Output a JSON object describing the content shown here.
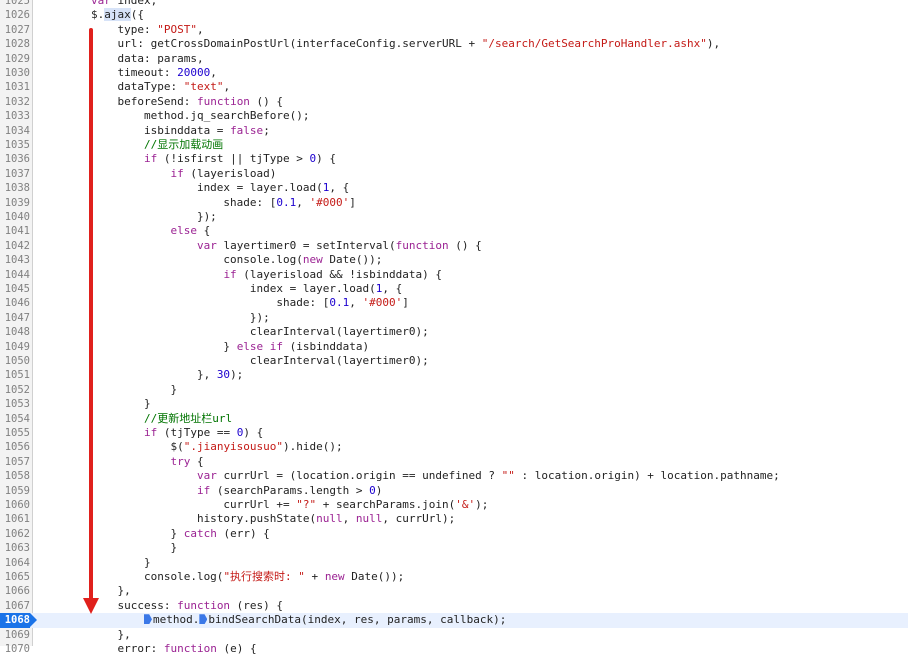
{
  "editor": {
    "current_line": "1068",
    "lines": [
      {
        "n": "1025",
        "segs": [
          [
            "        ",
            ""
          ],
          [
            "var",
            "kw"
          ],
          [
            " index;",
            ""
          ]
        ]
      },
      {
        "n": "1026",
        "segs": [
          [
            "        $.",
            ""
          ],
          [
            "ajax",
            "hl"
          ],
          [
            "({",
            ""
          ]
        ]
      },
      {
        "n": "1027",
        "segs": [
          [
            "            type: ",
            ""
          ],
          [
            "\"POST\"",
            "str"
          ],
          [
            ",",
            ""
          ]
        ]
      },
      {
        "n": "1028",
        "segs": [
          [
            "            url: getCrossDomainPostUrl(interfaceConfig.serverURL + ",
            ""
          ],
          [
            "\"/search/GetSearchProHandler.ashx\"",
            "str"
          ],
          [
            "),",
            ""
          ]
        ]
      },
      {
        "n": "1029",
        "segs": [
          [
            "            data: params,",
            ""
          ]
        ]
      },
      {
        "n": "1030",
        "segs": [
          [
            "            timeout: ",
            ""
          ],
          [
            "20000",
            "num"
          ],
          [
            ",",
            ""
          ]
        ]
      },
      {
        "n": "1031",
        "segs": [
          [
            "            dataType: ",
            ""
          ],
          [
            "\"text\"",
            "str"
          ],
          [
            ",",
            ""
          ]
        ]
      },
      {
        "n": "1032",
        "segs": [
          [
            "            beforeSend: ",
            ""
          ],
          [
            "function",
            "kw"
          ],
          [
            " () {",
            ""
          ]
        ]
      },
      {
        "n": "1033",
        "segs": [
          [
            "                method.jq_searchBefore();",
            ""
          ]
        ]
      },
      {
        "n": "1034",
        "segs": [
          [
            "                isbinddata = ",
            ""
          ],
          [
            "false",
            "kw"
          ],
          [
            ";",
            ""
          ]
        ]
      },
      {
        "n": "1035",
        "segs": [
          [
            "                ",
            ""
          ],
          [
            "//显示加载动画",
            "com"
          ]
        ]
      },
      {
        "n": "1036",
        "segs": [
          [
            "                ",
            ""
          ],
          [
            "if",
            "kw"
          ],
          [
            " (!isfirst || tjType > ",
            ""
          ],
          [
            "0",
            "num"
          ],
          [
            ") {",
            ""
          ]
        ]
      },
      {
        "n": "1037",
        "segs": [
          [
            "                    ",
            ""
          ],
          [
            "if",
            "kw"
          ],
          [
            " (layerisload)",
            ""
          ]
        ]
      },
      {
        "n": "1038",
        "segs": [
          [
            "                        index = layer.load(",
            ""
          ],
          [
            "1",
            "num"
          ],
          [
            ", {",
            ""
          ]
        ]
      },
      {
        "n": "1039",
        "segs": [
          [
            "                            shade: [",
            ""
          ],
          [
            "0.1",
            "num"
          ],
          [
            ", ",
            ""
          ],
          [
            "'#000'",
            "str"
          ],
          [
            "]",
            ""
          ]
        ]
      },
      {
        "n": "1040",
        "segs": [
          [
            "                        });",
            ""
          ]
        ]
      },
      {
        "n": "1041",
        "segs": [
          [
            "                    ",
            ""
          ],
          [
            "else",
            "kw"
          ],
          [
            " {",
            ""
          ]
        ]
      },
      {
        "n": "1042",
        "segs": [
          [
            "                        ",
            ""
          ],
          [
            "var",
            "kw"
          ],
          [
            " layertimer0 = setInterval(",
            ""
          ],
          [
            "function",
            "kw"
          ],
          [
            " () {",
            ""
          ]
        ]
      },
      {
        "n": "1043",
        "segs": [
          [
            "                            console.log(",
            ""
          ],
          [
            "new",
            "kw"
          ],
          [
            " Date());",
            ""
          ]
        ]
      },
      {
        "n": "1044",
        "segs": [
          [
            "                            ",
            ""
          ],
          [
            "if",
            "kw"
          ],
          [
            " (layerisload && !isbinddata) {",
            ""
          ]
        ]
      },
      {
        "n": "1045",
        "segs": [
          [
            "                                index = layer.load(",
            ""
          ],
          [
            "1",
            "num"
          ],
          [
            ", {",
            ""
          ]
        ]
      },
      {
        "n": "1046",
        "segs": [
          [
            "                                    shade: [",
            ""
          ],
          [
            "0.1",
            "num"
          ],
          [
            ", ",
            ""
          ],
          [
            "'#000'",
            "str"
          ],
          [
            "]",
            ""
          ]
        ]
      },
      {
        "n": "1047",
        "segs": [
          [
            "                                });",
            ""
          ]
        ]
      },
      {
        "n": "1048",
        "segs": [
          [
            "                                clearInterval(layertimer0);",
            ""
          ]
        ]
      },
      {
        "n": "1049",
        "segs": [
          [
            "                            } ",
            ""
          ],
          [
            "else if",
            "kw"
          ],
          [
            " (isbinddata)",
            ""
          ]
        ]
      },
      {
        "n": "1050",
        "segs": [
          [
            "                                clearInterval(layertimer0);",
            ""
          ]
        ]
      },
      {
        "n": "1051",
        "segs": [
          [
            "                        }, ",
            ""
          ],
          [
            "30",
            "num"
          ],
          [
            ");",
            ""
          ]
        ]
      },
      {
        "n": "1052",
        "segs": [
          [
            "                    }",
            ""
          ]
        ]
      },
      {
        "n": "1053",
        "segs": [
          [
            "                }",
            ""
          ]
        ]
      },
      {
        "n": "1054",
        "segs": [
          [
            "                ",
            ""
          ],
          [
            "//更新地址栏url",
            "com"
          ]
        ]
      },
      {
        "n": "1055",
        "segs": [
          [
            "                ",
            ""
          ],
          [
            "if",
            "kw"
          ],
          [
            " (tjType == ",
            ""
          ],
          [
            "0",
            "num"
          ],
          [
            ") {",
            ""
          ]
        ]
      },
      {
        "n": "1056",
        "segs": [
          [
            "                    $(",
            ""
          ],
          [
            "\".jianyisousuo\"",
            "str"
          ],
          [
            ").hide();",
            ""
          ]
        ]
      },
      {
        "n": "1057",
        "segs": [
          [
            "                    ",
            ""
          ],
          [
            "try",
            "kw"
          ],
          [
            " {",
            ""
          ]
        ]
      },
      {
        "n": "1058",
        "segs": [
          [
            "                        ",
            ""
          ],
          [
            "var",
            "kw"
          ],
          [
            " currUrl = (location.origin == undefined ? ",
            ""
          ],
          [
            "\"\"",
            "str"
          ],
          [
            " : location.origin) + location.pathname;",
            ""
          ]
        ]
      },
      {
        "n": "1059",
        "segs": [
          [
            "                        ",
            ""
          ],
          [
            "if",
            "kw"
          ],
          [
            " (searchParams.length > ",
            ""
          ],
          [
            "0",
            "num"
          ],
          [
            ")",
            ""
          ]
        ]
      },
      {
        "n": "1060",
        "segs": [
          [
            "                            currUrl += ",
            ""
          ],
          [
            "\"?\"",
            "str"
          ],
          [
            " + searchParams.join(",
            ""
          ],
          [
            "'&'",
            "str"
          ],
          [
            ");",
            ""
          ]
        ]
      },
      {
        "n": "1061",
        "segs": [
          [
            "                        history.pushState(",
            ""
          ],
          [
            "null",
            "kw"
          ],
          [
            ", ",
            ""
          ],
          [
            "null",
            "kw"
          ],
          [
            ", currUrl);",
            ""
          ]
        ]
      },
      {
        "n": "1062",
        "segs": [
          [
            "                    } ",
            ""
          ],
          [
            "catch",
            "kw"
          ],
          [
            " (err) {",
            ""
          ]
        ]
      },
      {
        "n": "1063",
        "segs": [
          [
            "                    }",
            ""
          ]
        ]
      },
      {
        "n": "1064",
        "segs": [
          [
            "                }",
            ""
          ]
        ]
      },
      {
        "n": "1065",
        "segs": [
          [
            "                console.log(",
            ""
          ],
          [
            "\"执行搜索时: \"",
            "str"
          ],
          [
            " + ",
            ""
          ],
          [
            "new",
            "kw"
          ],
          [
            " Date());",
            ""
          ]
        ]
      },
      {
        "n": "1066",
        "segs": [
          [
            "            },",
            ""
          ]
        ]
      },
      {
        "n": "1067",
        "segs": [
          [
            "            success: ",
            ""
          ],
          [
            "function",
            "kw"
          ],
          [
            " (res) {",
            ""
          ]
        ]
      },
      {
        "n": "1068",
        "segs": [
          [
            "                ",
            ""
          ],
          [
            "",
            "bp"
          ],
          [
            "method.",
            ""
          ],
          [
            "",
            "bp"
          ],
          [
            "bindSearchData(index, res, params, callback);",
            ""
          ]
        ]
      },
      {
        "n": "1069",
        "segs": [
          [
            "            },",
            ""
          ]
        ]
      },
      {
        "n": "1070",
        "segs": [
          [
            "            error: ",
            ""
          ],
          [
            "function",
            "kw"
          ],
          [
            " (e) {",
            ""
          ]
        ]
      }
    ]
  },
  "annotation": {
    "color": "#e0201c"
  }
}
